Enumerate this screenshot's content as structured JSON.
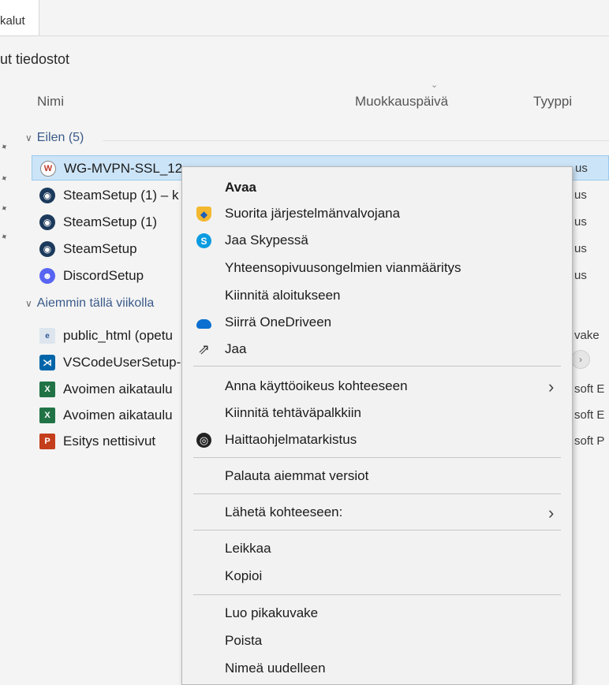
{
  "ribbon": {
    "tab_label": "kalut"
  },
  "section": {
    "title": "ut tiedostot"
  },
  "columns": {
    "name": "Nimi",
    "date": "Muokkauspäivä",
    "type": "Tyyppi",
    "sort_indicator": "⌄"
  },
  "groups": [
    {
      "label": "Eilen (5)"
    },
    {
      "label": "Aiemmin tällä viikolla"
    }
  ],
  "files": [
    {
      "name": "WG-MVPN-SSL_12",
      "type": "us",
      "icon": "wg-icon"
    },
    {
      "name": "SteamSetup (1) – k",
      "type": "us",
      "icon": "steam-icon"
    },
    {
      "name": "SteamSetup (1)",
      "type": "us",
      "icon": "steam-icon"
    },
    {
      "name": "SteamSetup",
      "type": "us",
      "icon": "steam-icon"
    },
    {
      "name": "DiscordSetup",
      "type": "us",
      "icon": "discord-icon"
    },
    {
      "name": "public_html (opetu",
      "type": "vake",
      "icon": "html-file-icon"
    },
    {
      "name": "VSCodeUserSetup-",
      "type": "",
      "icon": "vscode-icon"
    },
    {
      "name": "Avoimen aikataulu",
      "type": "soft E",
      "icon": "excel-icon"
    },
    {
      "name": "Avoimen aikataulu",
      "type": "soft E",
      "icon": "excel-icon"
    },
    {
      "name": "Esitys nettisivut",
      "type": "soft P",
      "icon": "powerpoint-icon"
    }
  ],
  "context_menu": {
    "items": [
      {
        "label": "Avaa",
        "icon": ""
      },
      {
        "label": "Suorita järjestelmänvalvojana",
        "icon": "uac-shield-icon"
      },
      {
        "label": "Jaa Skypessä",
        "icon": "skype-icon"
      },
      {
        "label": "Yhteensopivuusongelmien vianmääritys",
        "icon": ""
      },
      {
        "label": "Kiinnitä aloitukseen",
        "icon": ""
      },
      {
        "label": "Siirrä OneDriveen",
        "icon": "onedrive-icon"
      },
      {
        "label": "Jaa",
        "icon": "share-icon"
      },
      {
        "label": "Anna käyttöoikeus kohteeseen",
        "icon": "",
        "submenu": "›"
      },
      {
        "label": "Kiinnitä tehtäväpalkkiin",
        "icon": ""
      },
      {
        "label": "Haittaohjelmatarkistus",
        "icon": "defender-icon"
      },
      {
        "label": "Palauta aiemmat versiot",
        "icon": ""
      },
      {
        "label": "Lähetä kohteeseen:",
        "icon": "",
        "submenu": "›"
      },
      {
        "label": "Leikkaa",
        "icon": ""
      },
      {
        "label": "Kopioi",
        "icon": ""
      },
      {
        "label": "Luo pikakuvake",
        "icon": ""
      },
      {
        "label": "Poista",
        "icon": ""
      },
      {
        "label": "Nimeä uudelleen",
        "icon": ""
      }
    ]
  },
  "colors": {
    "selection": "#cce4f7",
    "selection_border": "#99c9ef",
    "menu_bg": "#f2f2f2"
  }
}
